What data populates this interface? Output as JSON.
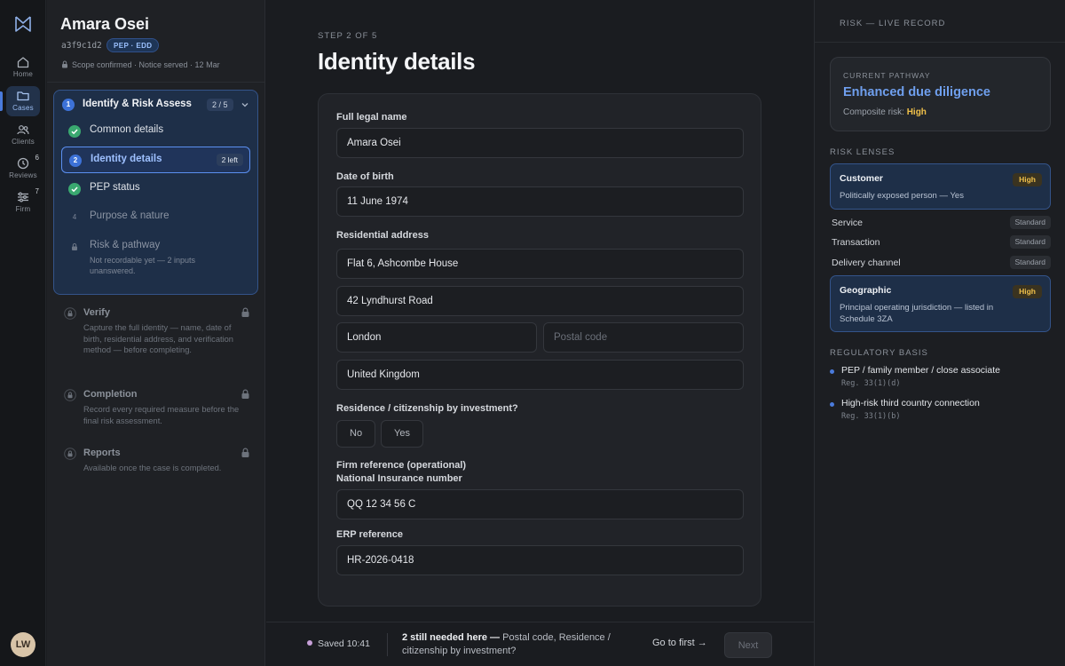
{
  "rail": {
    "items": [
      {
        "label": "Home",
        "icon": "home-icon"
      },
      {
        "label": "Cases",
        "icon": "folder-icon"
      },
      {
        "label": "Clients",
        "icon": "users-icon"
      },
      {
        "label": "Reviews",
        "icon": "clock-icon",
        "count": "6"
      },
      {
        "label": "Firm",
        "icon": "sliders-icon",
        "count": "7"
      }
    ],
    "avatar": "LW"
  },
  "case": {
    "name": "Amara Osei",
    "id": "a3f9c1d2",
    "badge": "PEP · EDD",
    "scope": "Scope confirmed · Notice served · 12 Mar"
  },
  "sidebar": {
    "group": {
      "num": "1",
      "title": "Identify & Risk Assess",
      "count": "2 / 5"
    },
    "steps": [
      {
        "label": "Common details",
        "state": "done"
      },
      {
        "label": "Identity details",
        "state": "current",
        "num": "2",
        "left": "2 left"
      },
      {
        "label": "PEP status",
        "state": "done"
      },
      {
        "label": "Purpose & nature",
        "state": "todo",
        "num": "4"
      },
      {
        "label": "Risk & pathway",
        "state": "locked",
        "sub": "Not recordable yet — 2 inputs unanswered."
      }
    ],
    "locked": [
      {
        "title": "Verify",
        "desc": "Capture the full identity — name, date of birth, residential address, and verification method — before completing."
      },
      {
        "title": "Completion",
        "desc": "Record every required measure before the final risk assessment."
      },
      {
        "title": "Reports",
        "desc": "Available once the case is completed."
      }
    ]
  },
  "main": {
    "step_count": "STEP 2 OF 5",
    "title": "Identity details",
    "fields": {
      "full_name_label": "Full legal name",
      "full_name": "Amara Osei",
      "dob_label": "Date of birth",
      "dob": "11 June 1974",
      "address_label": "Residential address",
      "address1": "Flat 6, Ashcombe House",
      "address2": "42 Lyndhurst Road",
      "city": "London",
      "postcode_placeholder": "Postal code",
      "country": "United Kingdom",
      "rcbi_label": "Residence / citizenship by investment?",
      "rcbi_no": "No",
      "rcbi_yes": "Yes",
      "firm_ref_label": "Firm reference (operational)",
      "ni_label": "National Insurance number",
      "ni": "QQ 12 34 56 C",
      "erp_label": "ERP reference",
      "erp": "HR-2026-0418"
    },
    "footer": {
      "saved": "Saved 10:41",
      "needed_bold": "2 still needed here —",
      "needed_rest": "Postal code, Residence / citizenship by investment?",
      "go_first": "Go to first →",
      "next": "Next"
    }
  },
  "right": {
    "header": "RISK — LIVE RECORD",
    "pathway": {
      "kicker": "CURRENT PATHWAY",
      "value": "Enhanced due diligence",
      "composite_label": "Composite risk:",
      "composite_value": "High"
    },
    "lenses_title": "RISK LENSES",
    "lenses": {
      "customer": {
        "name": "Customer",
        "level": "High",
        "desc": "Politically exposed person — Yes"
      },
      "service": {
        "name": "Service",
        "level": "Standard"
      },
      "transaction": {
        "name": "Transaction",
        "level": "Standard"
      },
      "delivery": {
        "name": "Delivery channel",
        "level": "Standard"
      },
      "geographic": {
        "name": "Geographic",
        "level": "High",
        "desc": "Principal operating jurisdiction — listed in Schedule 3ZA"
      }
    },
    "reg_title": "REGULATORY BASIS",
    "regs": [
      {
        "text": "PEP / family member / close associate",
        "code": "Reg. 33(1)(d)"
      },
      {
        "text": "High-risk third country connection",
        "code": "Reg. 33(1)(b)"
      }
    ]
  },
  "colors": {
    "accent": "#4a7bdc",
    "high": "#f0c04a",
    "done": "#3aa870",
    "pathway": "#6f9fee"
  }
}
